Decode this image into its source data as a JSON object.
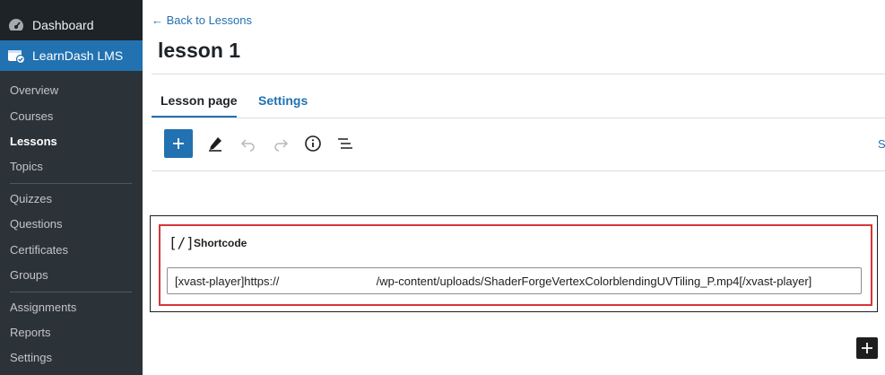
{
  "sidebar": {
    "dashboard_label": "Dashboard",
    "active_label": "LearnDash LMS",
    "items": [
      {
        "label": "Overview"
      },
      {
        "label": "Courses"
      },
      {
        "label": "Lessons"
      },
      {
        "label": "Topics"
      },
      {
        "label": "Quizzes"
      },
      {
        "label": "Questions"
      },
      {
        "label": "Certificates"
      },
      {
        "label": "Groups"
      },
      {
        "label": "Assignments"
      },
      {
        "label": "Reports"
      },
      {
        "label": "Settings"
      }
    ]
  },
  "header": {
    "back_link": "← Back to Lessons",
    "title": "lesson 1"
  },
  "tabs": [
    {
      "label": "Lesson page",
      "active": true
    },
    {
      "label": "Settings",
      "active": false
    }
  ],
  "toolbar": {
    "icons": [
      "plus-icon",
      "pencil-icon",
      "undo-icon",
      "redo-icon",
      "info-icon",
      "list-view-icon"
    ],
    "edge_text": "S"
  },
  "block": {
    "icon_text": "[/]",
    "label": "Shortcode",
    "value": "[xvast-player]https://                              /wp-content/uploads/ShaderForgeVertexColorblendingUVTiling_P.mp4[/xvast-player]"
  },
  "colors": {
    "accent": "#2271b1",
    "sidebar_bg": "#1d2327",
    "submenu_bg": "#2c3338",
    "highlight": "#d63638"
  }
}
